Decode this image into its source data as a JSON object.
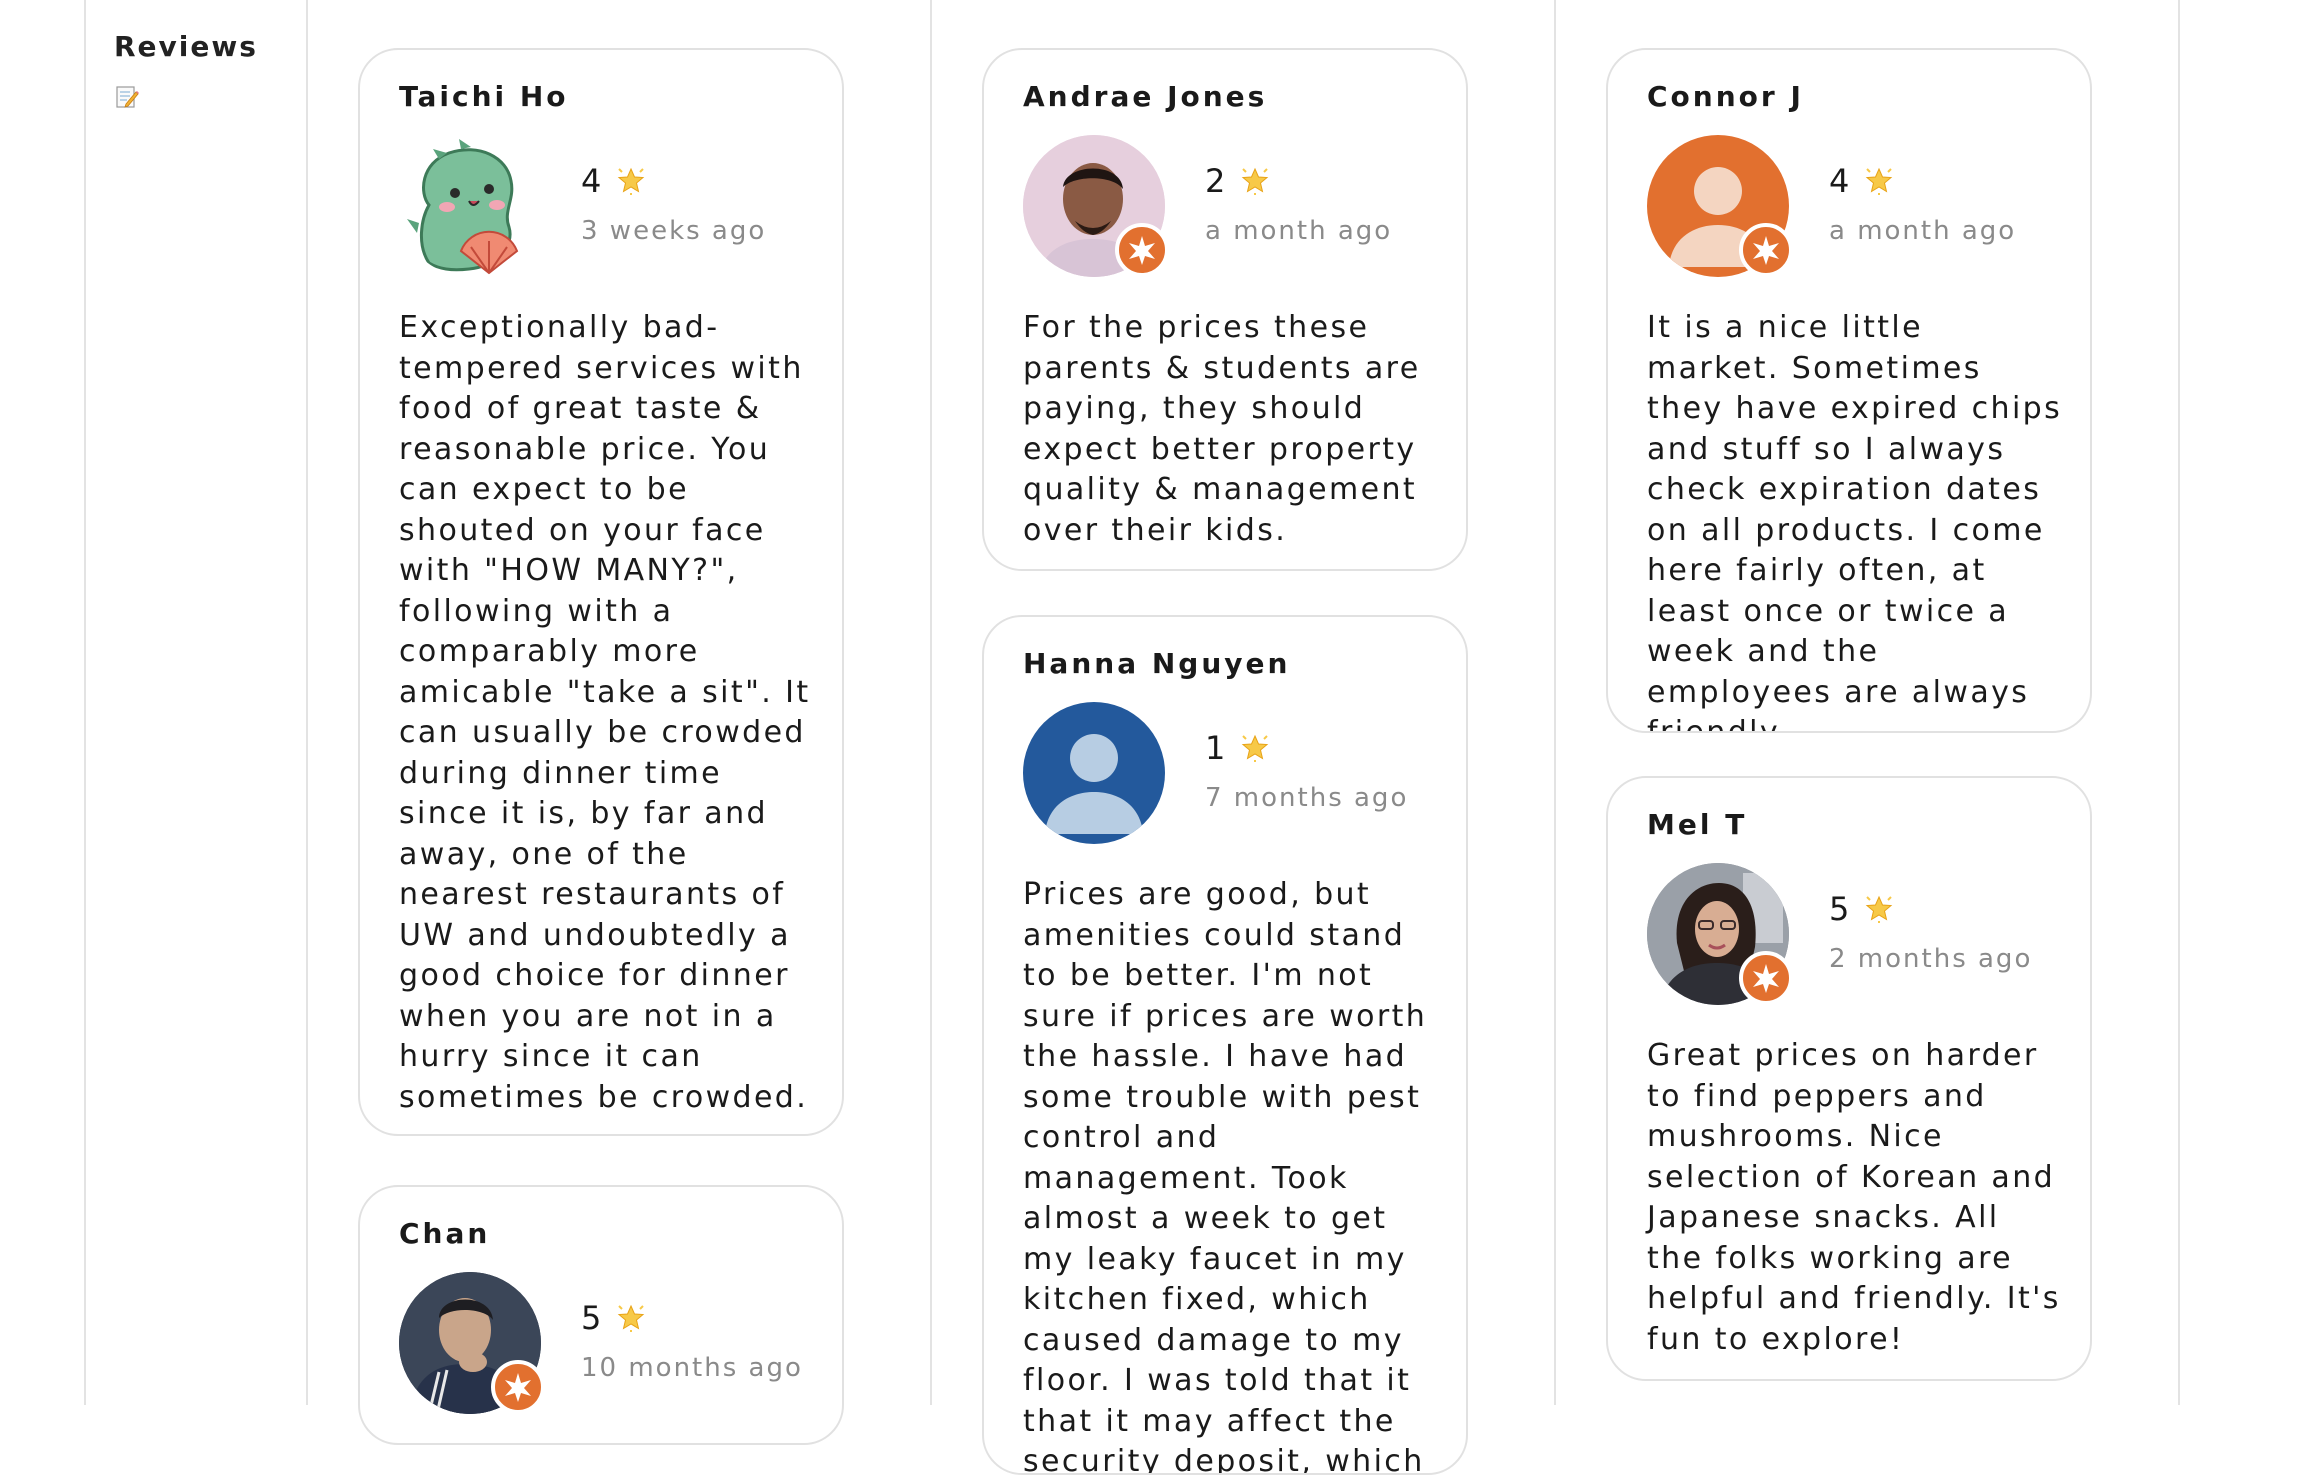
{
  "sidebar": {
    "title": "Reviews",
    "icon": "memo-icon"
  },
  "star_icon": "glowing-star-icon",
  "accent_color": "#e2702f",
  "reviews": [
    {
      "name": "Taichi Ho",
      "rating": "4",
      "time": "3 weeks ago",
      "text": "Exceptionally bad-tempered services with food of great taste & reasonable price. You can expect to be shouted on your face with \"HOW MANY?\", following with a comparably more amicable \"take a sit\". It can usually be crowded during dinner time since it is, by far and away, one of the nearest restaurants of UW and undoubtedly a good choice for dinner when you are not in a hurry since it can sometimes be crowded.",
      "avatar": "green-dinosaur-avatar"
    },
    {
      "name": "Chan",
      "rating": "5",
      "time": "10 months ago",
      "text": "",
      "avatar": "photo-avatar"
    },
    {
      "name": "Andrae Jones",
      "rating": "2",
      "time": "a month ago",
      "text": "For the prices these parents & students are paying, they should expect better property quality & management over their kids.",
      "avatar": "photo-avatar"
    },
    {
      "name": "Hanna Nguyen",
      "rating": "1",
      "time": "7 months ago",
      "text": "Prices are good, but amenities could stand to be better. I'm not sure if prices are worth the hassle. I have had some trouble with pest control and management. Took almost a week to get my leaky faucet in my kitchen fixed, which caused damage to my floor. I was told that it that it may affect the security deposit, which",
      "avatar": "default-person-avatar"
    },
    {
      "name": "Connor J",
      "rating": "4",
      "time": "a month ago",
      "text": "It is a nice little market. Sometimes they have expired chips and stuff so I always check expiration dates on all products. I come here fairly often, at least once or twice a week and the employees are always friendly.",
      "avatar": "default-person-avatar"
    },
    {
      "name": "Mel T",
      "rating": "5",
      "time": "2 months ago",
      "text": "Great prices on harder to find peppers and mushrooms. Nice selection of Korean and Japanese snacks. All the folks working are helpful and friendly. It's fun to explore!",
      "avatar": "photo-avatar"
    }
  ]
}
